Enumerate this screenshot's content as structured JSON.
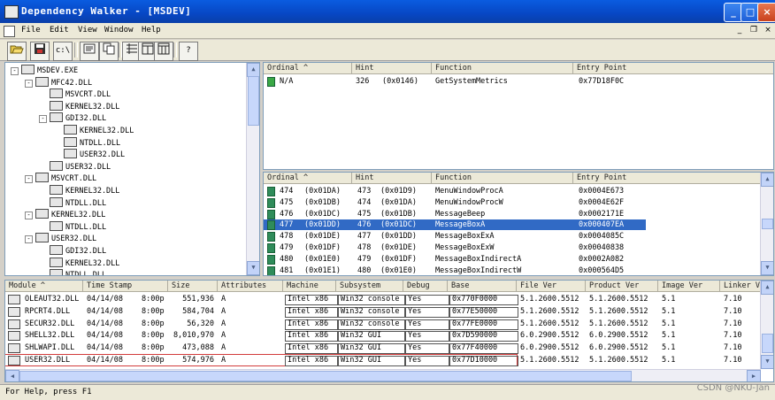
{
  "window": {
    "title": "Dependency Walker - [MSDEV]",
    "minimize_glyph": "_",
    "maximize_glyph": "□",
    "close_glyph": "×"
  },
  "menu": {
    "items": [
      "File",
      "Edit",
      "View",
      "Window",
      "Help"
    ],
    "mdi_min": "_",
    "mdi_restore": "❐",
    "mdi_close": "×"
  },
  "toolbar": {
    "icons": [
      "open-icon",
      "save-icon",
      "c-path-icon",
      "full-paths-icon",
      "copy-icon",
      "view-split-icon",
      "view-columns-icon",
      "view-list-icon",
      "help-icon"
    ],
    "c_label": "c:\\",
    "help_label": "?"
  },
  "tree": {
    "nodes": [
      {
        "label": "MSDEV.EXE",
        "depth": 0,
        "expander": "-"
      },
      {
        "label": "MFC42.DLL",
        "depth": 1,
        "expander": "-"
      },
      {
        "label": "MSVCRT.DLL",
        "depth": 2,
        "expander": ""
      },
      {
        "label": "KERNEL32.DLL",
        "depth": 2,
        "expander": ""
      },
      {
        "label": "GDI32.DLL",
        "depth": 2,
        "expander": "-"
      },
      {
        "label": "KERNEL32.DLL",
        "depth": 3,
        "expander": ""
      },
      {
        "label": "NTDLL.DLL",
        "depth": 3,
        "expander": ""
      },
      {
        "label": "USER32.DLL",
        "depth": 3,
        "expander": ""
      },
      {
        "label": "USER32.DLL",
        "depth": 2,
        "expander": ""
      },
      {
        "label": "MSVCRT.DLL",
        "depth": 1,
        "expander": "-"
      },
      {
        "label": "KERNEL32.DLL",
        "depth": 2,
        "expander": ""
      },
      {
        "label": "NTDLL.DLL",
        "depth": 2,
        "expander": ""
      },
      {
        "label": "KERNEL32.DLL",
        "depth": 1,
        "expander": "-"
      },
      {
        "label": "NTDLL.DLL",
        "depth": 2,
        "expander": ""
      },
      {
        "label": "USER32.DLL",
        "depth": 1,
        "expander": "-"
      },
      {
        "label": "GDI32.DLL",
        "depth": 2,
        "expander": ""
      },
      {
        "label": "KERNEL32.DLL",
        "depth": 2,
        "expander": ""
      },
      {
        "label": "NTDLL.DLL",
        "depth": 2,
        "expander": ""
      }
    ]
  },
  "imports": {
    "headers": [
      "Ordinal ^",
      "Hint",
      "Function",
      "Entry Point"
    ],
    "rows": [
      {
        "ordinal": "N/A",
        "hint": "326",
        "hint_hex": "(0x0146)",
        "function": "GetSystemMetrics",
        "entry": "0x77D18F0C"
      }
    ]
  },
  "exports": {
    "headers": [
      "Ordinal ^",
      "Hint",
      "Function",
      "Entry Point"
    ],
    "rows": [
      {
        "ord": "474",
        "ord_hex": "(0x01DA)",
        "hint": "473",
        "hint_hex": "(0x01D9)",
        "function": "MenuWindowProcA",
        "entry": "0x0004E673",
        "selected": false
      },
      {
        "ord": "475",
        "ord_hex": "(0x01DB)",
        "hint": "474",
        "hint_hex": "(0x01DA)",
        "function": "MenuWindowProcW",
        "entry": "0x0004E62F",
        "selected": false
      },
      {
        "ord": "476",
        "ord_hex": "(0x01DC)",
        "hint": "475",
        "hint_hex": "(0x01DB)",
        "function": "MessageBeep",
        "entry": "0x0002171E",
        "selected": false
      },
      {
        "ord": "477",
        "ord_hex": "(0x01DD)",
        "hint": "476",
        "hint_hex": "(0x01DC)",
        "function": "MessageBoxA",
        "entry": "0x000407EA",
        "selected": true
      },
      {
        "ord": "478",
        "ord_hex": "(0x01DE)",
        "hint": "477",
        "hint_hex": "(0x01DD)",
        "function": "MessageBoxExA",
        "entry": "0x0004085C",
        "selected": false
      },
      {
        "ord": "479",
        "ord_hex": "(0x01DF)",
        "hint": "478",
        "hint_hex": "(0x01DE)",
        "function": "MessageBoxExW",
        "entry": "0x00040838",
        "selected": false
      },
      {
        "ord": "480",
        "ord_hex": "(0x01E0)",
        "hint": "479",
        "hint_hex": "(0x01DF)",
        "function": "MessageBoxIndirectA",
        "entry": "0x0002A082",
        "selected": false
      },
      {
        "ord": "481",
        "ord_hex": "(0x01E1)",
        "hint": "480",
        "hint_hex": "(0x01E0)",
        "function": "MessageBoxIndirectW",
        "entry": "0x000564D5",
        "selected": false
      }
    ]
  },
  "modules": {
    "headers": [
      "Module ^",
      "Time Stamp",
      "Size",
      "Attributes",
      "Machine",
      "Subsystem",
      "Debug",
      "Base",
      "File Ver",
      "Product Ver",
      "Image Ver",
      "Linker V"
    ],
    "rows": [
      {
        "module": "OLEAUT32.DLL",
        "date": "04/14/08",
        "time": "8:00p",
        "size": "551,936",
        "attr": "A",
        "machine": "Intel x86",
        "subsystem": "Win32 console",
        "debug": "Yes",
        "base": "0x770F0000",
        "filever": "5.1.2600.5512",
        "prodver": "5.1.2600.5512",
        "imgver": "5.1",
        "linker": "7.10"
      },
      {
        "module": "RPCRT4.DLL",
        "date": "04/14/08",
        "time": "8:00p",
        "size": "584,704",
        "attr": "A",
        "machine": "Intel x86",
        "subsystem": "Win32 console",
        "debug": "Yes",
        "base": "0x77E50000",
        "filever": "5.1.2600.5512",
        "prodver": "5.1.2600.5512",
        "imgver": "5.1",
        "linker": "7.10"
      },
      {
        "module": "SECUR32.DLL",
        "date": "04/14/08",
        "time": "8:00p",
        "size": "56,320",
        "attr": "A",
        "machine": "Intel x86",
        "subsystem": "Win32 console",
        "debug": "Yes",
        "base": "0x77FE0000",
        "filever": "5.1.2600.5512",
        "prodver": "5.1.2600.5512",
        "imgver": "5.1",
        "linker": "7.10"
      },
      {
        "module": "SHELL32.DLL",
        "date": "04/14/08",
        "time": "8:00p",
        "size": "8,010,970",
        "attr": "A",
        "machine": "Intel x86",
        "subsystem": "Win32 GUI",
        "debug": "Yes",
        "base": "0x7D590000",
        "filever": "6.0.2900.5512",
        "prodver": "6.0.2900.5512",
        "imgver": "5.1",
        "linker": "7.10"
      },
      {
        "module": "SHLWAPI.DLL",
        "date": "04/14/08",
        "time": "8:00p",
        "size": "473,088",
        "attr": "A",
        "machine": "Intel x86",
        "subsystem": "Win32 GUI",
        "debug": "Yes",
        "base": "0x77F40000",
        "filever": "6.0.2900.5512",
        "prodver": "6.0.2900.5512",
        "imgver": "5.1",
        "linker": "7.10"
      },
      {
        "module": "USER32.DLL",
        "date": "04/14/08",
        "time": "8:00p",
        "size": "574,976",
        "attr": "A",
        "machine": "Intel x86",
        "subsystem": "Win32 GUI",
        "debug": "Yes",
        "base": "0x77D10000",
        "filever": "5.1.2600.5512",
        "prodver": "5.1.2600.5512",
        "imgver": "5.1",
        "linker": "7.10"
      }
    ]
  },
  "status": {
    "text": "For Help, press F1",
    "watermark": "CSDN @NKU-Jan"
  }
}
